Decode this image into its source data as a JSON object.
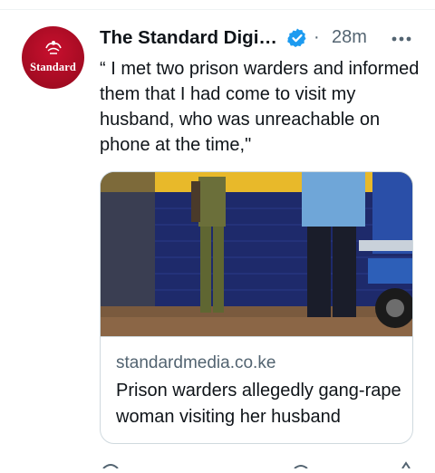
{
  "tweet": {
    "author": {
      "name": "The Standard Digital",
      "avatar_text": "Standard",
      "verified": true
    },
    "separator": "·",
    "timestamp": "28m",
    "more_icon": "more-horizontal-icon",
    "text": "“ I met two prison warders and informed them that I had come to visit my husband, who was unreachable on phone at the time,\"",
    "card": {
      "domain": "standardmedia.co.ke",
      "title": "Prison warders allegedly gang-rape woman visiting her husband"
    }
  },
  "colors": {
    "verified_badge": "#1d9bf0",
    "avatar_red": "#c8102e",
    "secondary_text": "#536471",
    "border": "#cfd9de"
  }
}
